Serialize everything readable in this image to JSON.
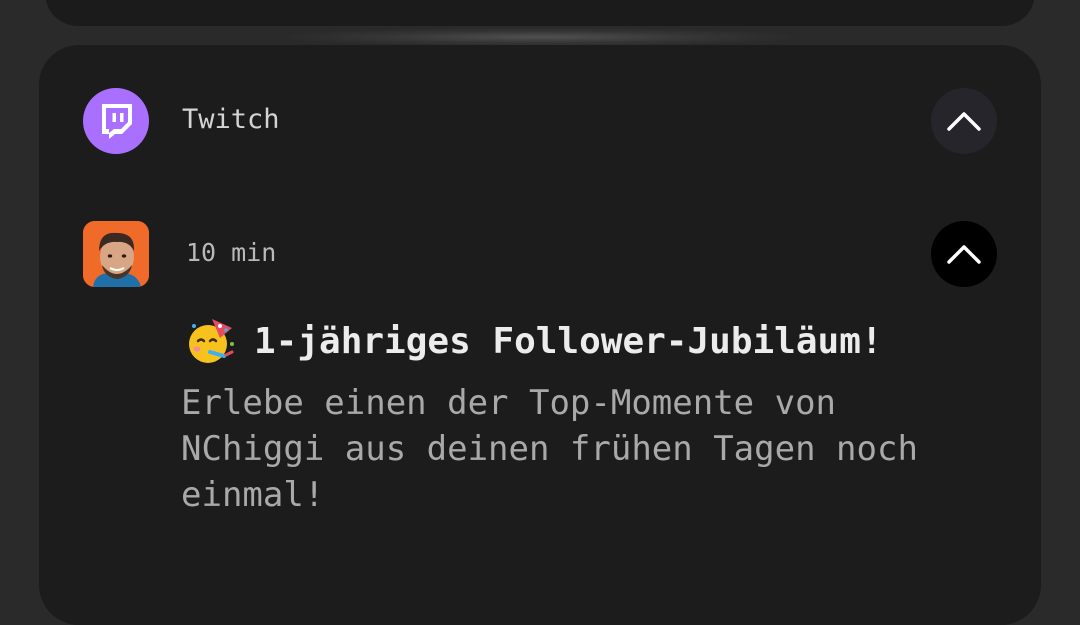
{
  "notification_group": {
    "app_name": "Twitch",
    "app_icon": "twitch-logo-icon",
    "app_color": "#a970ff"
  },
  "notification": {
    "time": "10 min",
    "title": "1-jähriges Follower-Jubiläum!",
    "title_emoji_icon": "party-face-icon",
    "body": "Erlebe einen der Top-Momente von NChiggi aus deinen frühen Tagen noch einmal!",
    "avatar": "streamer-avatar"
  },
  "colors": {
    "background": "#2a2a2a",
    "card": "#1c1c1c",
    "avatar_bg": "#f06a2a"
  }
}
